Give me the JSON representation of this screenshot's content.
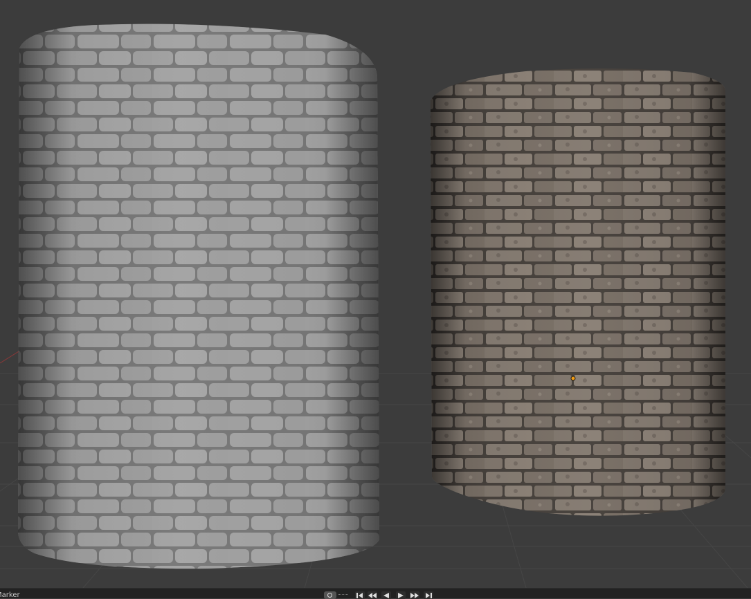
{
  "viewport": {
    "scene_objects": [
      "sculpted-stone-cylinder",
      "textured-stone-cylinder"
    ],
    "object_origin_color": "#f39c12",
    "background_color": "#3c3c3c"
  },
  "timeline": {
    "label": "Marker",
    "controls": [
      "jump-start",
      "previous-keyframe",
      "play-reverse",
      "play",
      "next-keyframe",
      "jump-end"
    ]
  }
}
